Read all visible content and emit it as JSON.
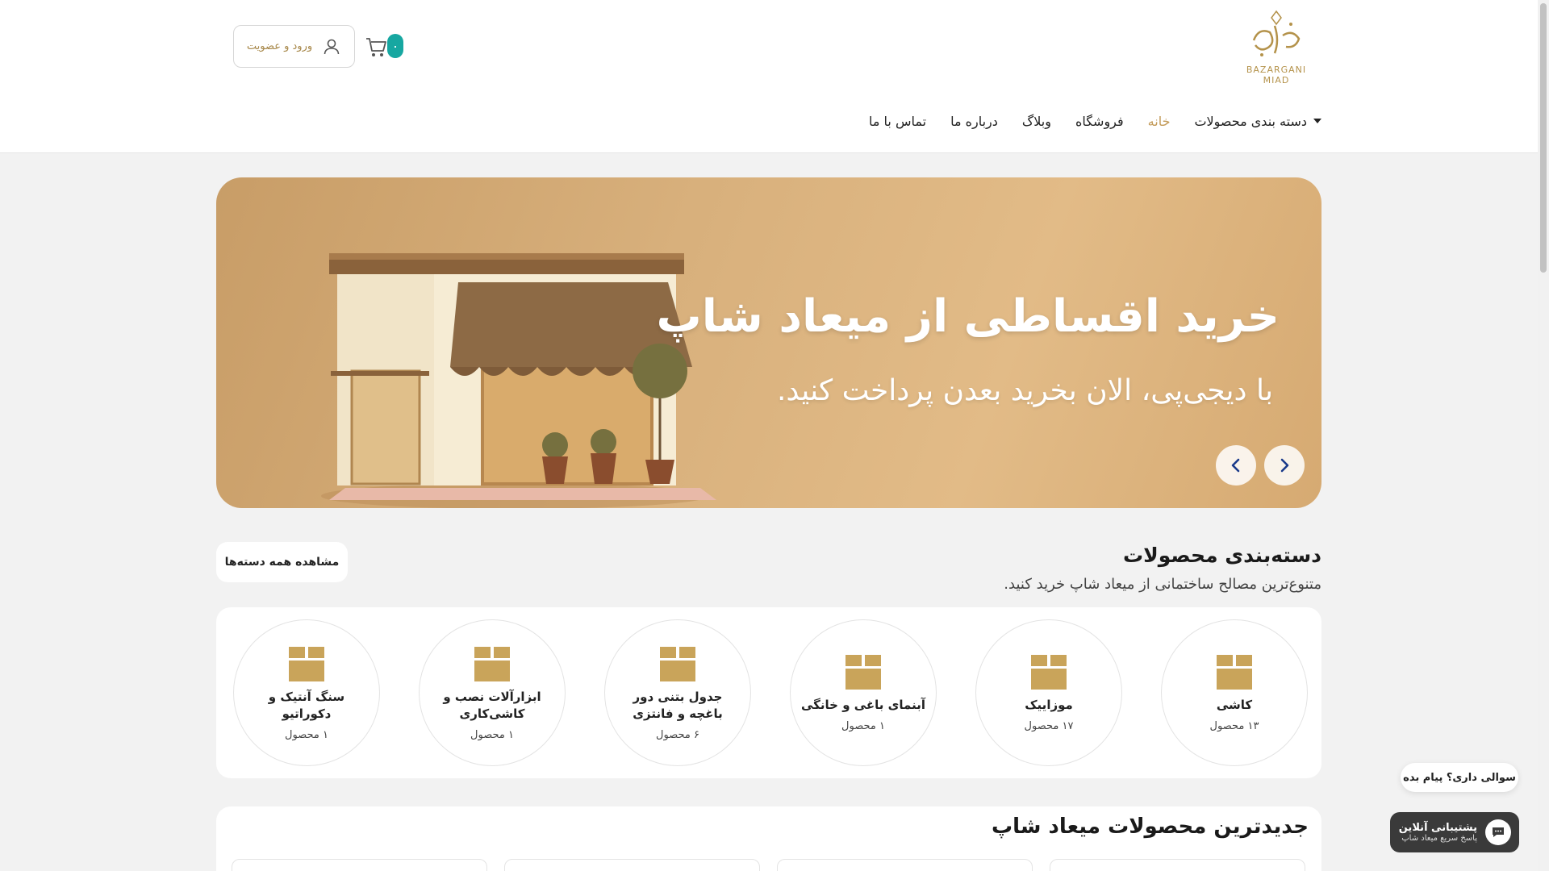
{
  "header": {
    "logo_text_line1": "BAZARGANI",
    "logo_text_line2": "MIAD",
    "login_label": "ورود و عضویت",
    "cart_count": "۰",
    "nav": [
      {
        "label": "دسته بندی محصولات"
      },
      {
        "label": "خانه"
      },
      {
        "label": "فروشگاه"
      },
      {
        "label": "وبلاگ"
      },
      {
        "label": "درباره ما"
      },
      {
        "label": "تماس با ما"
      }
    ]
  },
  "hero": {
    "title": "خرید اقساطی از میعاد شاپ",
    "subtitle": "با دیجی‌پی، الان بخرید بعدن پرداخت کنید."
  },
  "categories": {
    "title": "دسته‌بندی محصولات",
    "subtitle": "متنوع‌ترین مصالح ساختمانی از میعاد شاپ خرید کنید.",
    "view_all": "مشاهده همه دسته‌ها",
    "items": [
      {
        "name": "کاشی",
        "count": "۱۳ محصول"
      },
      {
        "name": "موزاییک",
        "count": "۱۷ محصول"
      },
      {
        "name": "آبنمای باغی و خانگی",
        "count": "۱ محصول"
      },
      {
        "name": "جدول بتنی دور باغچه و فانتزی",
        "count": "۶ محصول"
      },
      {
        "name": "ابزارآلات نصب و کاشی‌کاری",
        "count": "۱ محصول"
      },
      {
        "name": "سنگ آنتیک و دکوراتیو",
        "count": "۱ محصول"
      }
    ]
  },
  "newest": {
    "title": "جدیدترین محصولات میعاد شاپ"
  },
  "chat": {
    "bubble": "سوالی داری؟ پیام بده",
    "title": "پشتیبانی آنلاین",
    "desc": "پاسخ سریع میعاد شاپ"
  },
  "colors": {
    "accent": "#c39a58",
    "badge": "#17a7a1",
    "icon_gold": "#c9a45a"
  }
}
